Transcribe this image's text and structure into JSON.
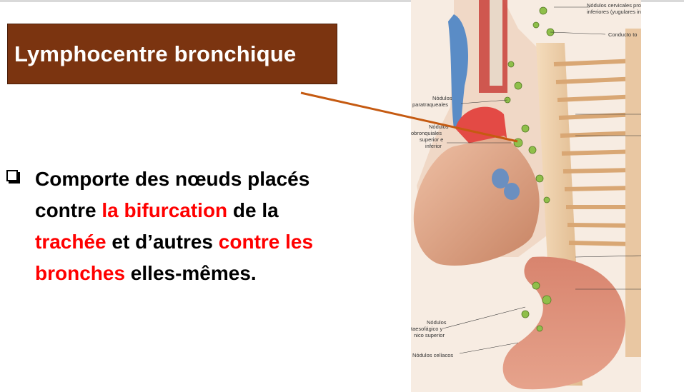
{
  "slide": {
    "title": "Lymphocentre bronchique",
    "body": {
      "line1": "Comporte des nœuds placés",
      "line2_part1": "contre ",
      "line2_red": "la bifurcation",
      "line2_part2": " de la",
      "line3_red1": "trachée",
      "line3_part": " et d’autres ",
      "line3_red2": "contre les",
      "line4_red": "bronches",
      "line4_part": " elles-mêmes."
    },
    "bullet_icon": "checkbox-square-icon"
  },
  "illustration": {
    "labels": {
      "cervicales_1": "Nódulos cervicales pro",
      "cervicales_2": "inferiores (yugulares in",
      "conducto": "Conducto to",
      "paratraqueales_1": "Nódulos",
      "paratraqueales_2": "paratraqueales",
      "bronquiales_1": "Nódulos",
      "bronquiales_2": "obronquiales",
      "bronquiales_3": "superior e",
      "bronquiales_4": "inferior",
      "esofagico_1": "Nódulos",
      "esofagico_2": "taesofágico y",
      "esofagico_3": "nico superior",
      "celiacos": "Nódulos celíacos"
    }
  },
  "colors": {
    "title_bg": "#7b3410",
    "title_text": "#ffffff",
    "highlight": "#ff0000",
    "pointer_line": "#c55a11"
  }
}
